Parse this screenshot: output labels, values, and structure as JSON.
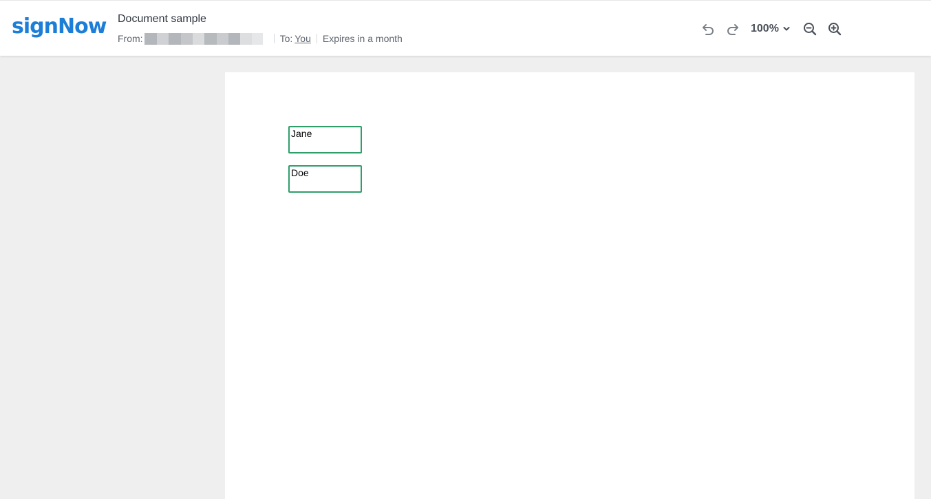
{
  "app": {
    "logo_text": "signNow",
    "brand_color": "#1c7ed6"
  },
  "document": {
    "title": "Document sample",
    "from_label": "From:",
    "to_label": "To:",
    "to_value": "You",
    "expires_text": "Expires in a month"
  },
  "toolbar": {
    "undo_icon": "undo-icon",
    "redo_icon": "redo-icon",
    "zoom_value": "100%",
    "zoom_out_icon": "zoom-out-icon",
    "zoom_in_icon": "zoom-in-icon"
  },
  "fields": [
    {
      "value": "Jane"
    },
    {
      "value": "Doe"
    }
  ],
  "colors": {
    "field_border": "#2e9e6a",
    "background": "#efefef"
  }
}
